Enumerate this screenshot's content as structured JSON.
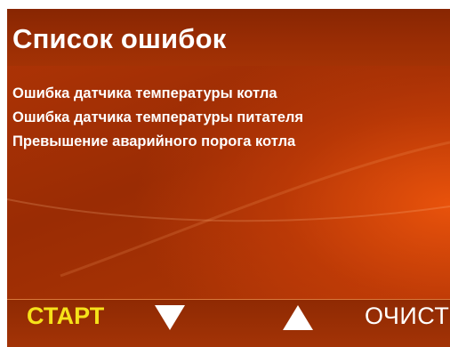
{
  "header": {
    "title": "Список ошибок"
  },
  "errors": [
    "Ошибка датчика температуры котла",
    "Ошибка датчика температуры питателя",
    "Превышение аварийного порога котла"
  ],
  "softkeys": {
    "start_label": "СТАРТ",
    "down_icon": "triangle-down-icon",
    "up_icon": "triangle-up-icon",
    "clear_label": "ОЧИСТ"
  },
  "colors": {
    "background": "#a33205",
    "start_label": "#f6e21a",
    "text": "#ffffff"
  }
}
